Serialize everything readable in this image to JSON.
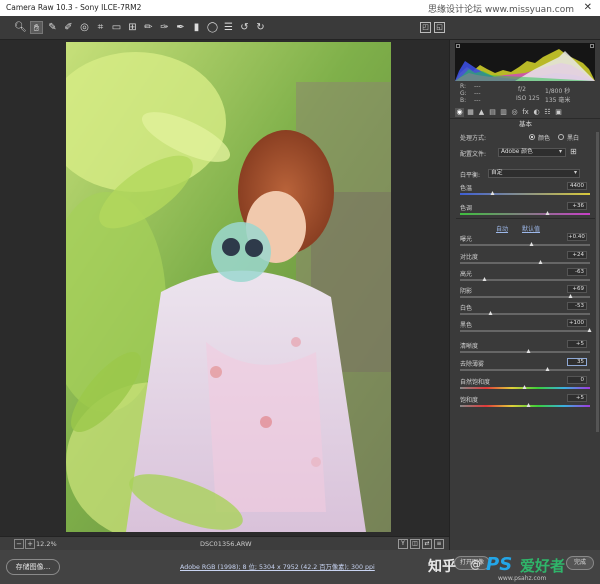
{
  "window": {
    "title": "Camera Raw 10.3  -  Sony ILCE-7RM2",
    "watermark": "思缘设计论坛 www.missyuan.com",
    "close_glyph": "✕"
  },
  "toolbar": {
    "tools": [
      {
        "icon": "zoom-icon",
        "glyph": "🔍︎"
      },
      {
        "icon": "hand-icon",
        "glyph": "✋︎"
      },
      {
        "icon": "white-balance-icon",
        "glyph": "✎"
      },
      {
        "icon": "color-sampler-icon",
        "glyph": "✐"
      },
      {
        "icon": "target-adjust-icon",
        "glyph": "◎"
      },
      {
        "icon": "crop-icon",
        "glyph": "⌗"
      },
      {
        "icon": "straighten-icon",
        "glyph": "▭"
      },
      {
        "icon": "transform-icon",
        "glyph": "⊞"
      },
      {
        "icon": "spot-removal-icon",
        "glyph": "✏"
      },
      {
        "icon": "red-eye-icon",
        "glyph": "✑"
      },
      {
        "icon": "adjustment-brush-icon",
        "glyph": "✒"
      },
      {
        "icon": "graduated-filter-icon",
        "glyph": "▮"
      },
      {
        "icon": "radial-filter-icon",
        "glyph": "◯"
      },
      {
        "icon": "preferences-icon",
        "glyph": "☰"
      },
      {
        "icon": "rotate-ccw-icon",
        "glyph": "↺"
      },
      {
        "icon": "rotate-cw-icon",
        "glyph": "↻"
      }
    ],
    "right_icon_1": "◰",
    "right_icon_2": "◱"
  },
  "status": {
    "zoom_minus": "−",
    "zoom_plus": "+",
    "zoom_value": "12.2%",
    "filename": "DSC01356.ARW",
    "icon_y": "Y",
    "icon_compare": "◫",
    "icon_swap": "⇄",
    "icon_settings": "≡"
  },
  "bottom": {
    "save_label": "存储图像...",
    "workflow_text": "Adobe RGB (1998); 8 位; 5304 x 7952 (42.2 百万像素); 300 ppi",
    "zhihu": "知乎",
    "at": "@",
    "ps_logo": "PS",
    "ps_cn": "爱好者",
    "ps_url": "www.psahz.com",
    "open_label": "打开图像",
    "done_label": "完成"
  },
  "histogram": {
    "r": "R:",
    "g": "G:",
    "b": "B:",
    "dash": "---",
    "aperture": "f/2",
    "shutter": "1/800 秒",
    "iso": "ISO 125",
    "focal": "135 毫米"
  },
  "panel": {
    "tabs": [
      {
        "icon": "basic-tab-icon",
        "glyph": "◉"
      },
      {
        "icon": "tone-curve-tab-icon",
        "glyph": "▦"
      },
      {
        "icon": "detail-tab-icon",
        "glyph": "▲"
      },
      {
        "icon": "hsl-tab-icon",
        "glyph": "▤"
      },
      {
        "icon": "split-toning-tab-icon",
        "glyph": "▥"
      },
      {
        "icon": "lens-tab-icon",
        "glyph": "◎"
      },
      {
        "icon": "effects-tab-icon",
        "glyph": "fx"
      },
      {
        "icon": "calibration-tab-icon",
        "glyph": "◐"
      },
      {
        "icon": "presets-tab-icon",
        "glyph": "☷"
      },
      {
        "icon": "snapshots-tab-icon",
        "glyph": "▣"
      }
    ],
    "section_title": "基本",
    "treatment_label": "处理方式:",
    "color_label": "颜色",
    "bw_label": "黑白",
    "profile_label": "配置文件:",
    "profile_value": "Adobe 颜色",
    "wb_label": "白平衡:",
    "wb_value": "自定",
    "auto_label": "自动",
    "default_label": "默认值",
    "sliders": [
      {
        "key": "temp",
        "label": "色温",
        "value": "4400",
        "pos": 0.25
      },
      {
        "key": "tint",
        "label": "色调",
        "value": "+36",
        "pos": 0.68
      },
      {
        "key": "exposure",
        "label": "曝光",
        "value": "+0.40",
        "pos": 0.55
      },
      {
        "key": "contrast",
        "label": "对比度",
        "value": "+24",
        "pos": 0.62
      },
      {
        "key": "highlights",
        "label": "高光",
        "value": "-63",
        "pos": 0.19
      },
      {
        "key": "shadows",
        "label": "阴影",
        "value": "+69",
        "pos": 0.85
      },
      {
        "key": "whites",
        "label": "白色",
        "value": "-53",
        "pos": 0.24
      },
      {
        "key": "blacks",
        "label": "黑色",
        "value": "+100",
        "pos": 1.0
      },
      {
        "key": "clarity",
        "label": "清晰度",
        "value": "+5",
        "pos": 0.53
      },
      {
        "key": "dehaze",
        "label": "去除薄雾",
        "value": "35",
        "pos": 0.68
      },
      {
        "key": "vibrance",
        "label": "自然饱和度",
        "value": "0",
        "pos": 0.5
      },
      {
        "key": "saturation",
        "label": "饱和度",
        "value": "+5",
        "pos": 0.53
      }
    ]
  }
}
